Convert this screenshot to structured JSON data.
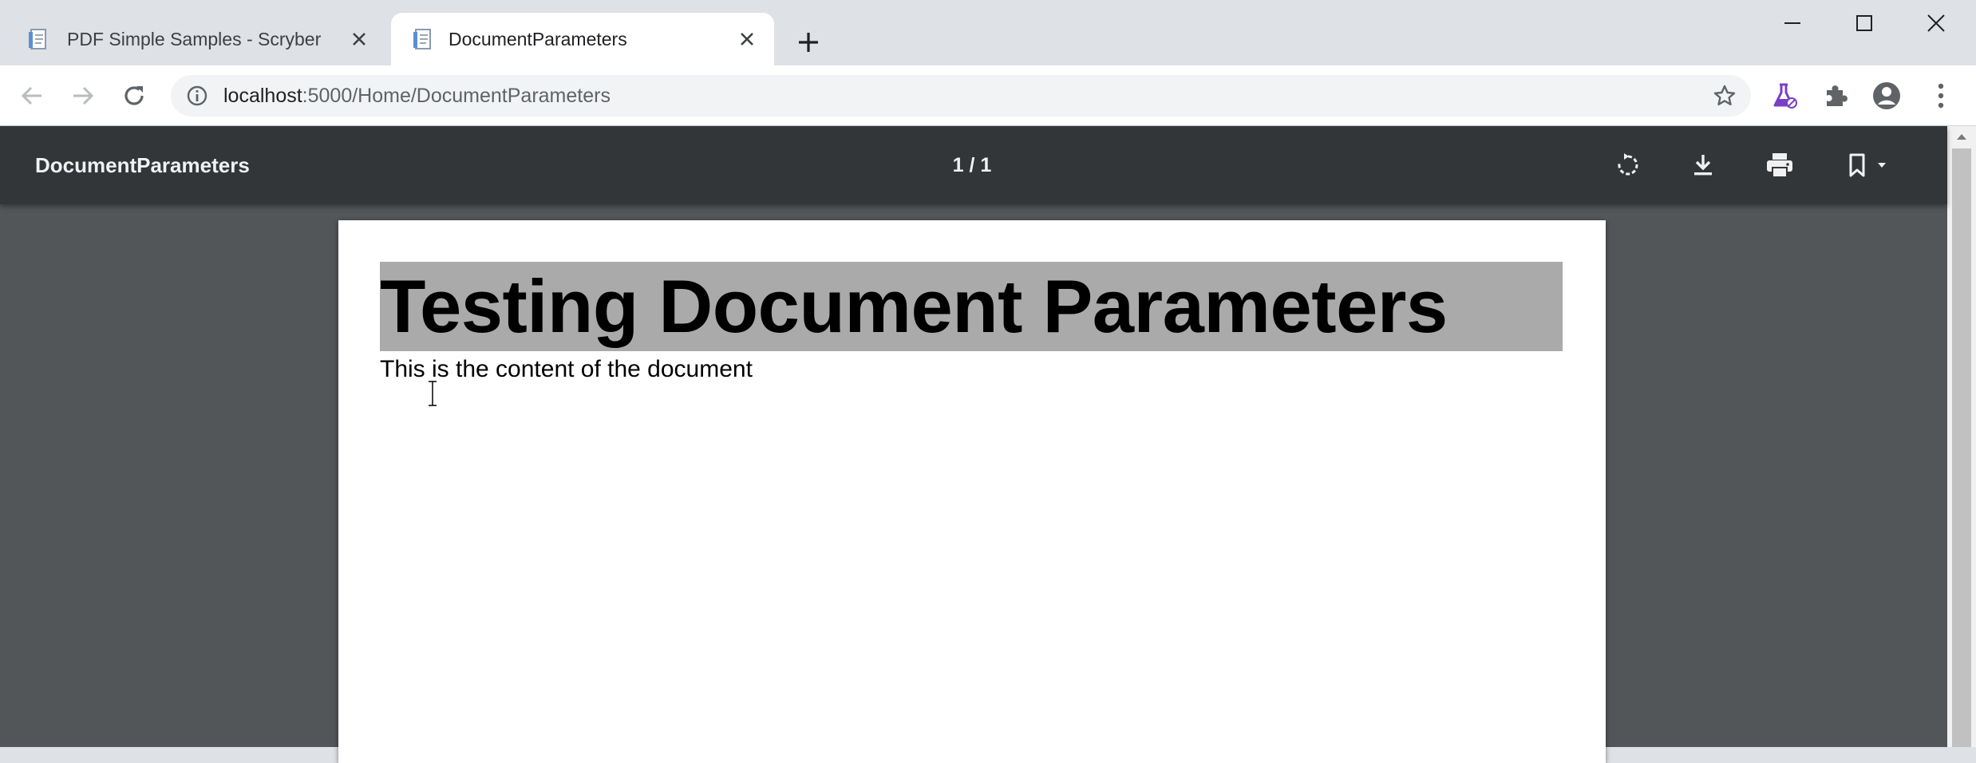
{
  "tabs": [
    {
      "title": "PDF Simple Samples - Scryber",
      "active": false
    },
    {
      "title": "DocumentParameters",
      "active": true
    }
  ],
  "address_bar": {
    "host": "localhost",
    "path": ":5000/Home/DocumentParameters"
  },
  "pdf_viewer": {
    "title": "DocumentParameters",
    "page_indicator": "1 / 1"
  },
  "document": {
    "heading": "Testing Document Parameters",
    "body": "This is the content of the document"
  },
  "colors": {
    "tabstrip": "#dee1e6",
    "viewer_toolbar": "#323639",
    "viewer_background": "#525659",
    "heading_highlight": "#aaaaaa",
    "labs_icon": "#7b3fc4"
  }
}
